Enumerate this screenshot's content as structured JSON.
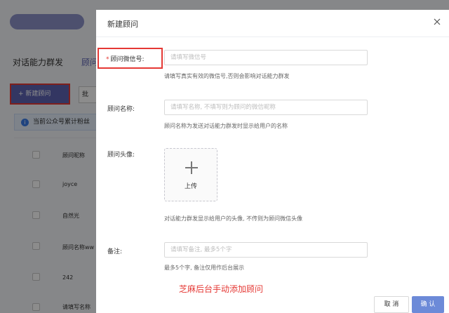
{
  "background": {
    "tabs": [
      "对话能力群发",
      "顾问"
    ],
    "new_button_label": "+ 新建顾问",
    "batch_button_label": "批",
    "alert_icon": "info-icon",
    "alert_text": "当前公众号累计粉丝",
    "table_header": "顾问昵称",
    "rows": [
      "joyce",
      "自然光",
      "顾问名称ww",
      "242",
      "请填写名称"
    ]
  },
  "dialog": {
    "title": "新建顾问",
    "close_icon": "close-icon",
    "wechat": {
      "required_mark": "*",
      "label": "顾问微信号:",
      "placeholder": "请填写微信号",
      "hint": "请填写真实有效的微信号,否则会影响对话能力群发"
    },
    "name": {
      "label": "顾问名称:",
      "placeholder": "请填写名称, 不填写则为顾问的微信昵称",
      "hint": "顾问名称为发送对话能力群发时显示给用户的名称"
    },
    "avatar": {
      "label": "顾问头像:",
      "upload_icon": "plus-icon",
      "upload_label": "上传",
      "hint": "对话能力群发显示给用户的头像, 不传则为顾问微信头像"
    },
    "note": {
      "label": "备注:",
      "placeholder": "请填写备注, 最多5个字",
      "hint": "最多5个字, 备注仅用作后台展示"
    },
    "annotation": "芝麻后台手动添加顾问",
    "cancel_label": "取 消",
    "ok_label": "确 认"
  },
  "colors": {
    "accent": "#6c8ad8",
    "highlight": "#e53935"
  }
}
